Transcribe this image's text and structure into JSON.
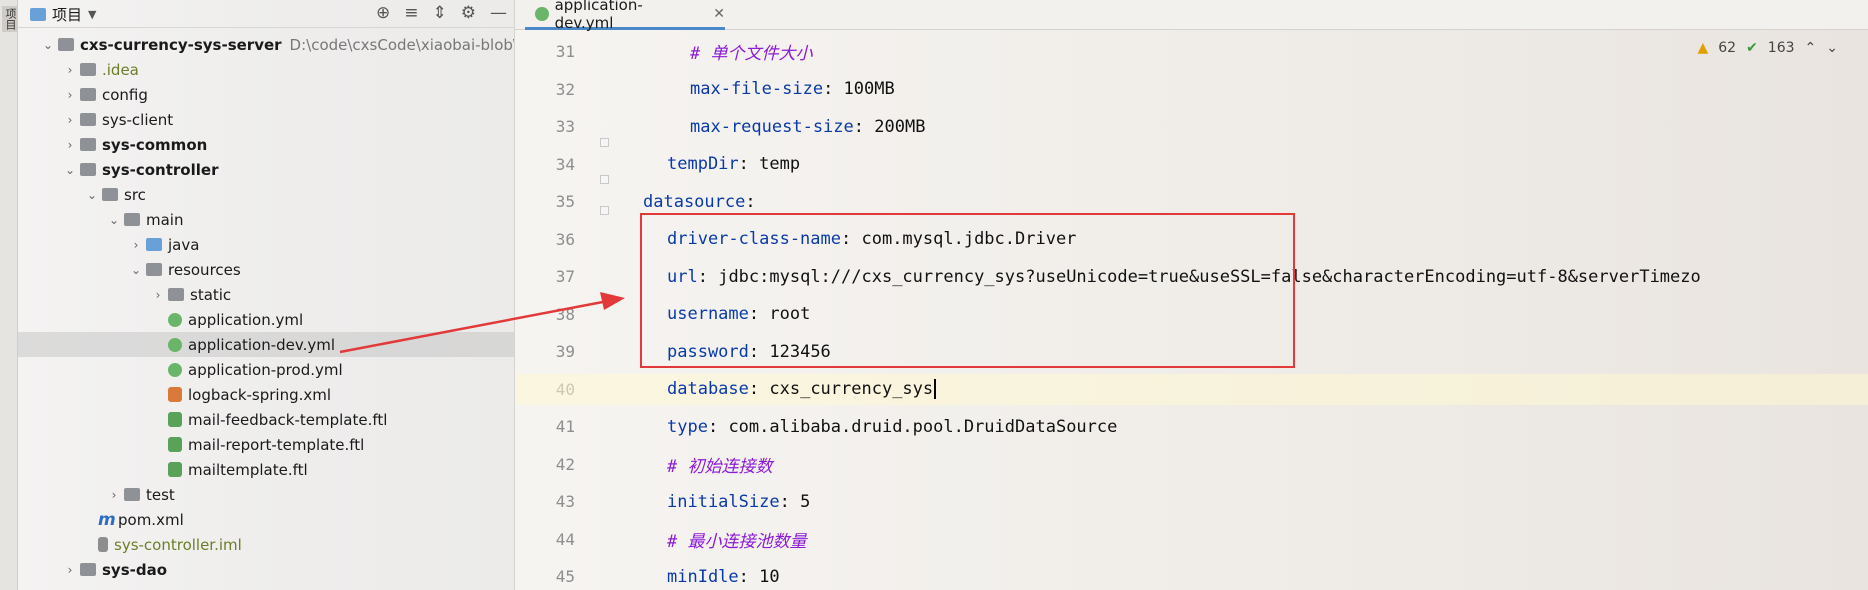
{
  "sidebar_strip": {
    "label": "项目"
  },
  "panel": {
    "title": "项目",
    "tree": [
      {
        "label": "cxs-currency-sys-server",
        "path": "D:\\code\\cxsCode\\xiaobai-blob\\cxs",
        "bold": true,
        "icon": "module-folder-icon"
      },
      {
        "label": ".idea",
        "icon": "folder-icon"
      },
      {
        "label": "config",
        "icon": "folder-icon"
      },
      {
        "label": "sys-client",
        "icon": "folder-icon"
      },
      {
        "label": "sys-common",
        "bold": true,
        "icon": "module-folder-icon"
      },
      {
        "label": "sys-controller",
        "bold": true,
        "icon": "module-folder-icon"
      },
      {
        "label": "src",
        "icon": "folder-icon"
      },
      {
        "label": "main",
        "icon": "folder-icon"
      },
      {
        "label": "java",
        "icon": "source-folder-icon"
      },
      {
        "label": "resources",
        "icon": "resources-folder-icon"
      },
      {
        "label": "static",
        "icon": "folder-icon"
      },
      {
        "label": "application.yml",
        "icon": "yml-file-icon"
      },
      {
        "label": "application-dev.yml",
        "icon": "yml-file-icon",
        "selected": true
      },
      {
        "label": "application-prod.yml",
        "icon": "yml-file-icon"
      },
      {
        "label": "logback-spring.xml",
        "icon": "xml-file-icon"
      },
      {
        "label": "mail-feedback-template.ftl",
        "icon": "ftl-file-icon"
      },
      {
        "label": "mail-report-template.ftl",
        "icon": "ftl-file-icon"
      },
      {
        "label": "mailtemplate.ftl",
        "icon": "ftl-file-icon"
      },
      {
        "label": "test",
        "icon": "folder-icon"
      },
      {
        "label": "pom.xml",
        "icon": "maven-icon"
      },
      {
        "label": "sys-controller.iml",
        "icon": "iml-file-icon"
      },
      {
        "label": "sys-dao",
        "bold": true,
        "icon": "module-folder-icon"
      }
    ]
  },
  "editor": {
    "tab_label": "application-dev.yml",
    "inspections": {
      "warnings": "62",
      "ok": "163"
    },
    "lines": [
      {
        "n": "31",
        "key": "",
        "sep": "",
        "value": "",
        "comment": "# 单个文件大小"
      },
      {
        "n": "32",
        "key": "max-file-size",
        "sep": ": ",
        "value": "100MB",
        "comment": ""
      },
      {
        "n": "33",
        "key": "max-request-size",
        "sep": ": ",
        "value": "200MB",
        "comment": ""
      },
      {
        "n": "34",
        "key": "tempDir",
        "sep": ": ",
        "value": "temp",
        "comment": ""
      },
      {
        "n": "35",
        "key": "datasource",
        "sep": ":",
        "value": "",
        "comment": ""
      },
      {
        "n": "36",
        "key": "driver-class-name",
        "sep": ": ",
        "value": "com.mysql.jdbc.Driver",
        "comment": ""
      },
      {
        "n": "37",
        "key": "url",
        "sep": ": ",
        "value": "jdbc:mysql:///cxs_currency_sys?useUnicode=true&useSSL=false&characterEncoding=utf-8&serverTimezo",
        "comment": ""
      },
      {
        "n": "38",
        "key": "username",
        "sep": ": ",
        "value": "root",
        "comment": ""
      },
      {
        "n": "39",
        "key": "password",
        "sep": ": ",
        "value": "123456",
        "comment": ""
      },
      {
        "n": "40",
        "key": "database",
        "sep": ": ",
        "value": "cxs_currency_sys",
        "comment": ""
      },
      {
        "n": "41",
        "key": "type",
        "sep": ": ",
        "value": "com.alibaba.druid.pool.DruidDataSource",
        "comment": ""
      },
      {
        "n": "42",
        "key": "",
        "sep": "",
        "value": "",
        "comment": "# 初始连接数"
      },
      {
        "n": "43",
        "key": "initialSize",
        "sep": ": ",
        "value": "5",
        "comment": ""
      },
      {
        "n": "44",
        "key": "",
        "sep": "",
        "value": "",
        "comment": "# 最小连接池数量"
      },
      {
        "n": "45",
        "key": "minIdle",
        "sep": ": ",
        "value": "10",
        "comment": ""
      }
    ]
  }
}
